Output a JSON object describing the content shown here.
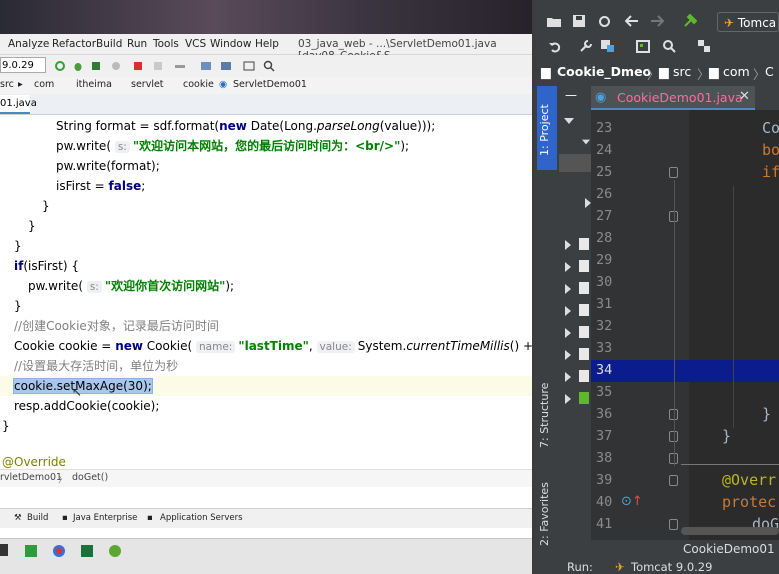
{
  "left_ide": {
    "menu": [
      "Analyze",
      "Refactor",
      "Build",
      "Run",
      "Tools",
      "VCS",
      "Window",
      "Help"
    ],
    "window_title": "03_java_web - ...\\ServletDemo01.java [day08_Cookie&S",
    "tomcat_version": "9.0.29",
    "breadcrumbs": [
      "src",
      "com",
      "itheima",
      "servlet",
      "cookie",
      "ServletDemo01"
    ],
    "file_tab": "01.java",
    "code_lines": [
      {
        "indent": 4,
        "parts": [
          [
            "t",
            "String format = sdf.format("
          ],
          [
            "kw",
            "new"
          ],
          [
            "t",
            " Date(Long."
          ],
          [
            "ita",
            "parseLong"
          ],
          [
            "t",
            "(value)));"
          ]
        ]
      },
      {
        "indent": 4,
        "parts": [
          [
            "t",
            "pw.write( "
          ],
          [
            "hint",
            "s:"
          ],
          [
            "str",
            "\"欢迎访问本网站，您的最后访问时间为：<br/>\""
          ],
          [
            "t",
            ");"
          ]
        ]
      },
      {
        "indent": 4,
        "parts": [
          [
            "t",
            "pw.write(format);"
          ]
        ]
      },
      {
        "indent": 4,
        "parts": [
          [
            "t",
            "isFirst = "
          ],
          [
            "kw",
            "false"
          ],
          [
            "t",
            ";"
          ]
        ]
      },
      {
        "indent": 3,
        "parts": [
          [
            "t",
            "}"
          ]
        ]
      },
      {
        "indent": 2,
        "parts": [
          [
            "t",
            "}"
          ]
        ]
      },
      {
        "indent": 1,
        "parts": [
          [
            "t",
            "}"
          ]
        ]
      },
      {
        "indent": 1,
        "parts": [
          [
            "kw",
            "if"
          ],
          [
            "t",
            "(isFirst) {"
          ]
        ]
      },
      {
        "indent": 2,
        "parts": [
          [
            "t",
            "pw.write( "
          ],
          [
            "hint",
            "s:"
          ],
          [
            "str",
            "\"欢迎你首次访问网站\""
          ],
          [
            "t",
            ");"
          ]
        ]
      },
      {
        "indent": 1,
        "parts": [
          [
            "t",
            "}"
          ]
        ]
      },
      {
        "indent": 1,
        "parts": [
          [
            "cmt",
            "//创建Cookie对象，记录最后访问时间"
          ]
        ]
      },
      {
        "indent": 1,
        "parts": [
          [
            "t",
            "Cookie cookie = "
          ],
          [
            "kw",
            "new"
          ],
          [
            "t",
            " Cookie( "
          ],
          [
            "hint",
            "name:"
          ],
          [
            "str",
            "\"lastTime\""
          ],
          [
            "t",
            ", "
          ],
          [
            "hint",
            "value:"
          ],
          [
            "t",
            "System."
          ],
          [
            "ita",
            "currentTimeMillis"
          ],
          [
            "t",
            "() + \"\");"
          ]
        ]
      },
      {
        "indent": 1,
        "parts": [
          [
            "cmt",
            "//设置最大存活时间，单位为秒"
          ]
        ]
      },
      {
        "indent": 1,
        "parts": [
          [
            "sel",
            "cookie.setMaxAge(30);"
          ]
        ],
        "current": true
      },
      {
        "indent": 1,
        "parts": [
          [
            "t",
            "resp.addCookie(cookie);"
          ]
        ]
      },
      {
        "indent": 0,
        "parts": [
          [
            "t",
            "}"
          ]
        ]
      }
    ],
    "override_text": "@Override",
    "method_crumbs": [
      "rvletDemo01",
      "doGet()"
    ],
    "bottom_tools": [
      "Build",
      "Java Enterprise",
      "Application Servers"
    ]
  },
  "right_ide": {
    "toolbar_run_config": "Tomca",
    "breadcrumbs": [
      "Cookie_Dmeo",
      "src",
      "com",
      "C"
    ],
    "side_labels": [
      "1: Project",
      "7: Structure",
      "2: Favorites"
    ],
    "file_tab": "CookieDemo01.java",
    "line_numbers": [
      "23",
      "24",
      "25",
      "26",
      "27",
      "28",
      "29",
      "30",
      "31",
      "32",
      "33",
      "34",
      "35",
      "36",
      "37",
      "38",
      "39",
      "40",
      "41"
    ],
    "current_line": "34",
    "code_fragments": [
      {
        "line": "23",
        "text": "Co",
        "color": "#a9b7c6"
      },
      {
        "line": "24",
        "text": "bo",
        "color": "#cc7832"
      },
      {
        "line": "25",
        "text": "if",
        "color": "#cc7832"
      },
      {
        "line": "36",
        "text": "}",
        "color": "#a9b7c6"
      },
      {
        "line": "37",
        "text": "}",
        "color": "#a9b7c6"
      },
      {
        "line": "39",
        "text": "@Overr",
        "color": "#bbb529"
      },
      {
        "line": "40",
        "text": "protec",
        "color": "#cc7832"
      },
      {
        "line": "41",
        "text": "doG",
        "color": "#a9b7c6"
      }
    ],
    "status_class": "CookieDemo01",
    "run_label": "Run:",
    "run_config": "Tomcat 9.0.29"
  }
}
